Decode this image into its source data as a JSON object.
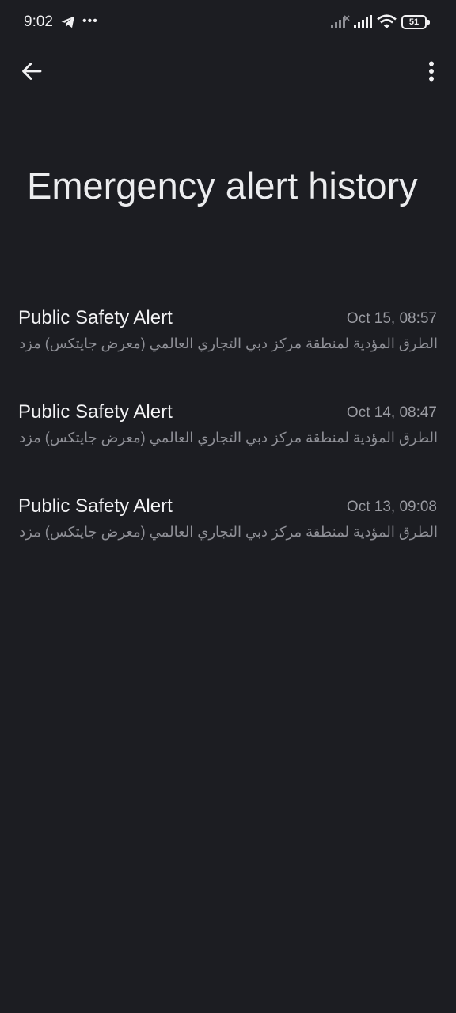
{
  "status_bar": {
    "time": "9:02",
    "battery_level": "51",
    "icons": [
      "telegram-icon",
      "more-notifications-icon",
      "signal-no-service-icon",
      "signal-icon",
      "wifi-icon",
      "battery-icon"
    ]
  },
  "toolbar": {
    "back_icon": "arrow-left-icon",
    "more_icon": "more-vertical-icon"
  },
  "page": {
    "title": "Emergency alert history"
  },
  "alerts": [
    {
      "title": "Public Safety Alert",
      "time": "Oct 15, 08:57",
      "body": "الطرق المؤدية لمنطقة مركز دبي التجاري العالمي (معرض جايتكس) مزدحمة.."
    },
    {
      "title": "Public Safety Alert",
      "time": "Oct 14, 08:47",
      "body": "الطرق المؤدية لمنطقة مركز دبي التجاري العالمي (معرض جايتكس) مزدحمة.."
    },
    {
      "title": "Public Safety Alert",
      "time": "Oct 13, 09:08",
      "body": "الطرق المؤدية لمنطقة مركز دبي التجاري العالمي (معرض جايتكس) مزدحمة.."
    }
  ],
  "colors": {
    "background": "#1c1d22",
    "primary_text": "#ecedef",
    "secondary_text": "#9b9ca3"
  }
}
